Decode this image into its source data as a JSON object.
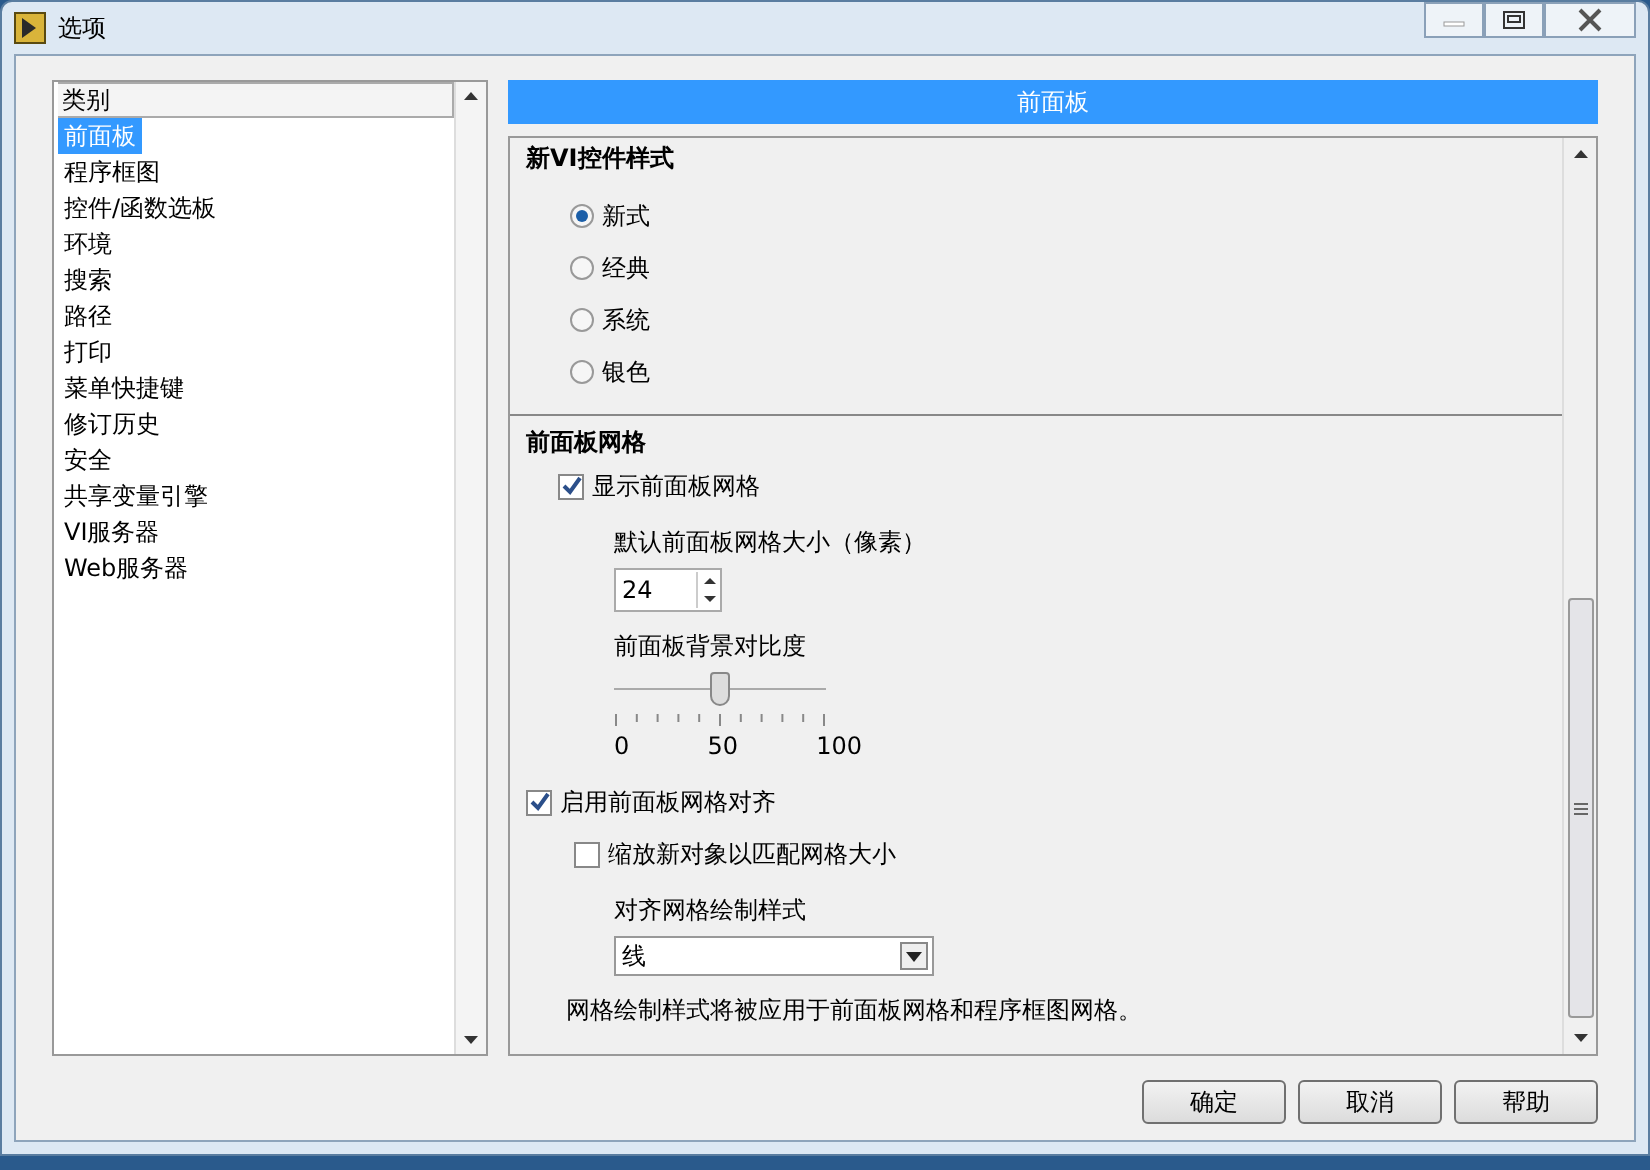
{
  "window": {
    "title": "选项"
  },
  "category_list": {
    "header": "类别",
    "items": [
      {
        "label": "前面板",
        "selected": true
      },
      {
        "label": "程序框图",
        "selected": false
      },
      {
        "label": "控件/函数选板",
        "selected": false
      },
      {
        "label": "环境",
        "selected": false
      },
      {
        "label": "搜索",
        "selected": false
      },
      {
        "label": "路径",
        "selected": false
      },
      {
        "label": "打印",
        "selected": false
      },
      {
        "label": "菜单快捷键",
        "selected": false
      },
      {
        "label": "修订历史",
        "selected": false
      },
      {
        "label": "安全",
        "selected": false
      },
      {
        "label": "共享变量引擎",
        "selected": false
      },
      {
        "label": "VI服务器",
        "selected": false
      },
      {
        "label": "Web服务器",
        "selected": false
      }
    ]
  },
  "panel": {
    "header": "前面板",
    "control_style": {
      "title": "新VI控件样式",
      "options": [
        {
          "label": "新式",
          "selected": true
        },
        {
          "label": "经典",
          "selected": false
        },
        {
          "label": "系统",
          "selected": false
        },
        {
          "label": "银色",
          "selected": false
        }
      ]
    },
    "grid": {
      "title": "前面板网格",
      "show_grid": {
        "label": "显示前面板网格",
        "checked": true
      },
      "size_label": "默认前面板网格大小（像素）",
      "size_value": "24",
      "contrast_label": "前面板背景对比度",
      "contrast": {
        "level": 0.5,
        "tick_labels": [
          "0",
          "50",
          "100"
        ]
      },
      "snap": {
        "label": "启用前面板网格对齐",
        "checked": true
      },
      "scale": {
        "label": "缩放新对象以匹配网格大小",
        "checked": false
      },
      "style_label": "对齐网格绘制样式",
      "style_value": "线",
      "note": "网格绘制样式将被应用于前面板网格和程序框图网格。"
    }
  },
  "buttons": [
    "确定",
    "取消",
    "帮助"
  ]
}
